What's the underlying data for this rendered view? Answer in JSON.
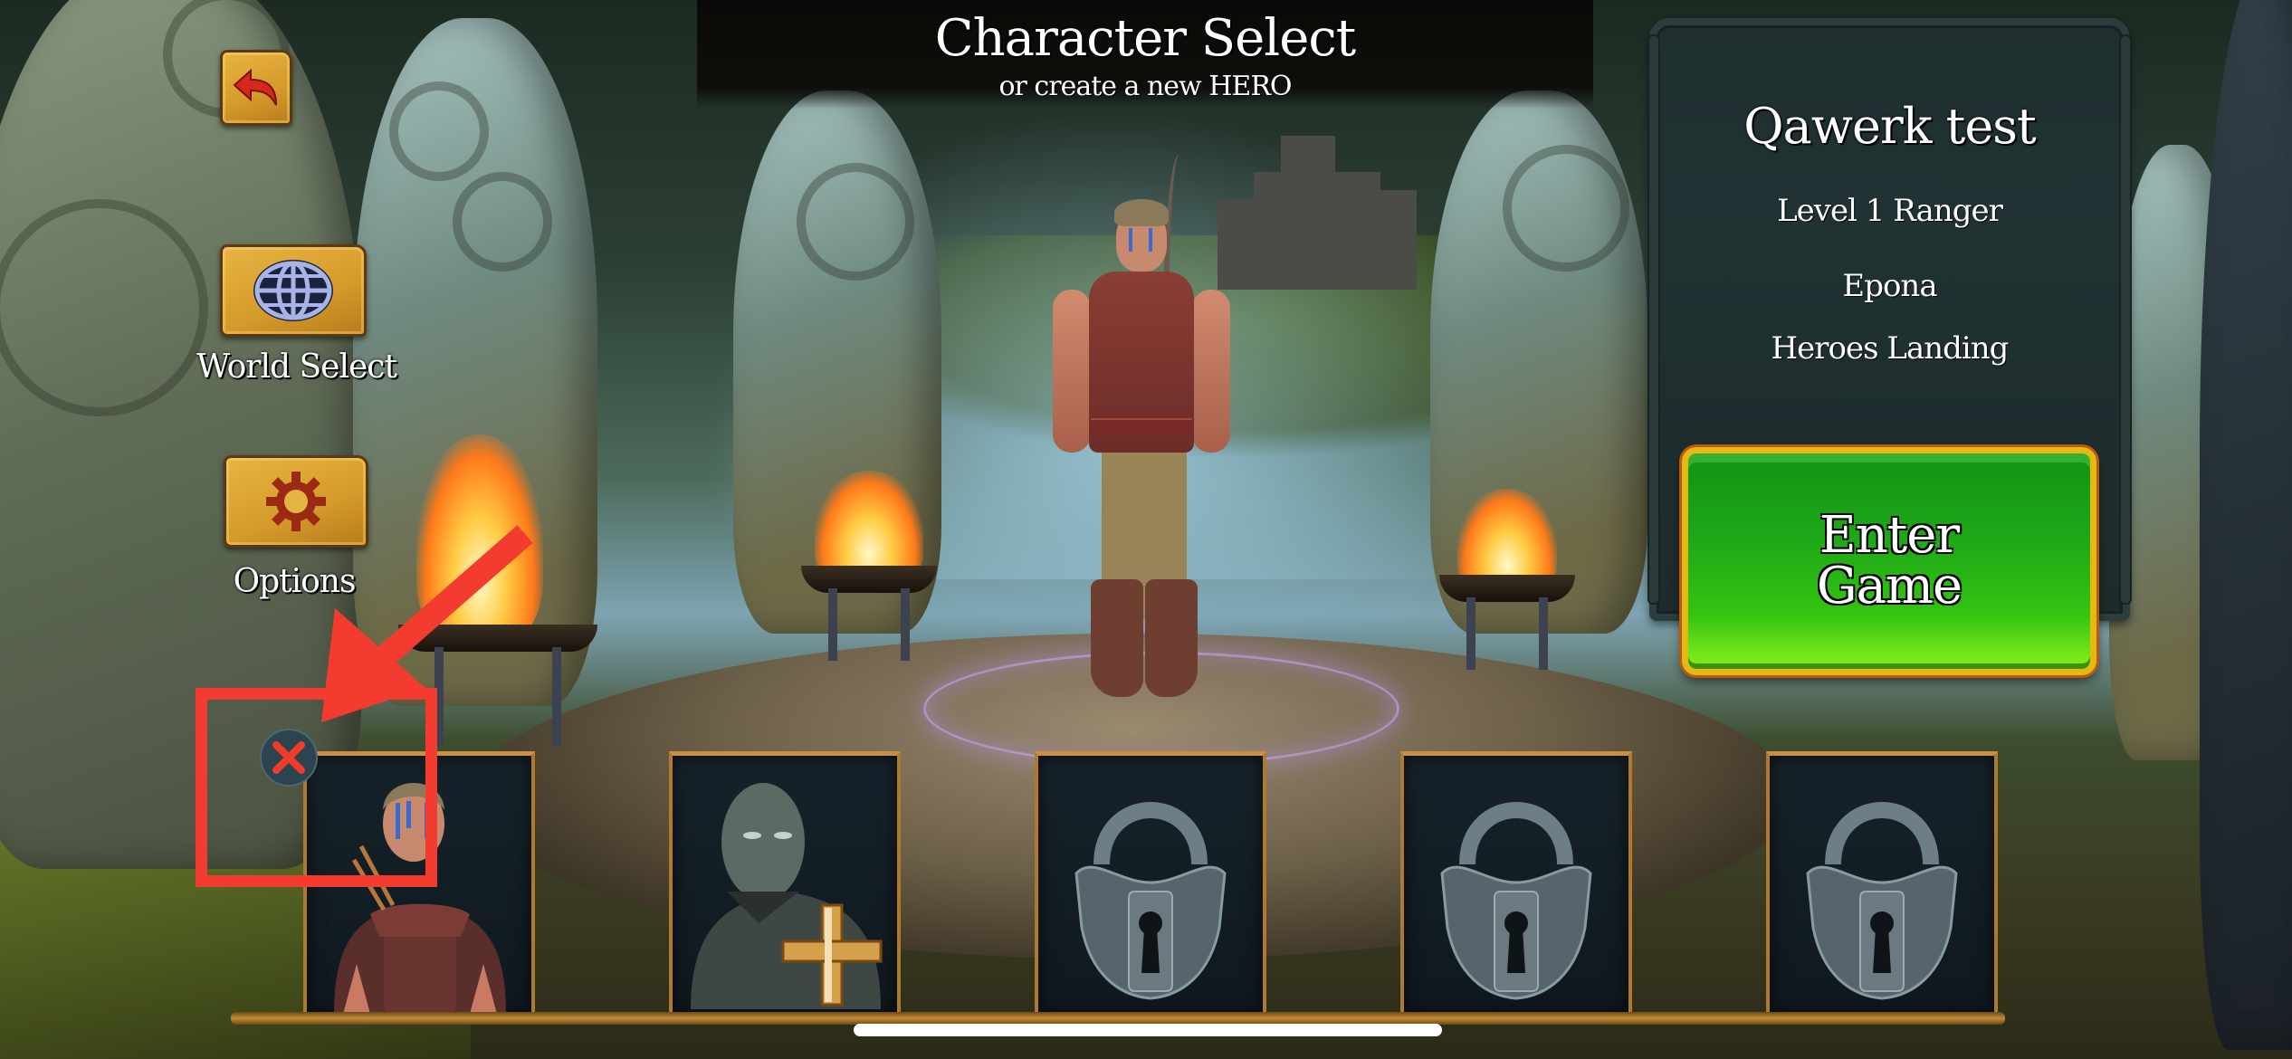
{
  "header": {
    "title": "Character Select",
    "subtitle": "or create a new HERO"
  },
  "left_menu": {
    "back": {
      "icon": "back-arrow-icon"
    },
    "world_select": {
      "icon": "globe-icon",
      "label": "World Select"
    },
    "options": {
      "icon": "gear-icon",
      "label": "Options"
    }
  },
  "character_info": {
    "name": "Qawerk test",
    "level_class": "Level 1 Ranger",
    "world": "Epona",
    "location": "Heroes Landing"
  },
  "enter_game": {
    "label": "Enter\nGame"
  },
  "character_slots": [
    {
      "state": "selected-character",
      "icon": "ranger-portrait",
      "has_delete": true
    },
    {
      "state": "create-new",
      "icon": "new-hero-plus"
    },
    {
      "state": "locked",
      "icon": "padlock-icon"
    },
    {
      "state": "locked",
      "icon": "padlock-icon"
    },
    {
      "state": "locked",
      "icon": "padlock-icon"
    }
  ],
  "delete_button": {
    "icon": "close-x-icon"
  },
  "annotation": {
    "color": "#f33b30",
    "target": "delete-character-button"
  },
  "colors": {
    "panel_bg": "#1f2f30",
    "button_green": "#1ea818",
    "button_border": "#e6b812",
    "menu_gold": "#d49a2a",
    "slot_border": "#b07a2c"
  }
}
